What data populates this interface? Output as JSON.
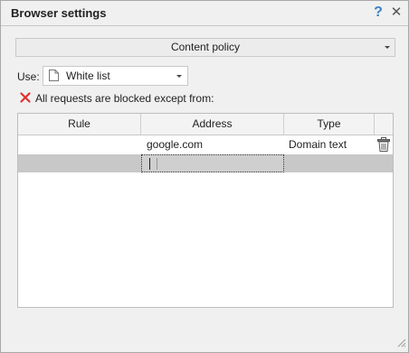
{
  "window": {
    "title": "Browser settings"
  },
  "titlebar": {
    "help_glyph": "?",
    "close_glyph": "✕"
  },
  "policy": {
    "selected": "Content policy"
  },
  "use": {
    "label": "Use:",
    "selected": "White list",
    "icon": "document-icon"
  },
  "notice": {
    "icon": "red-x-icon",
    "text": "All requests are blocked except from:",
    "icon_color": "#e0312f"
  },
  "table": {
    "columns": [
      "Rule",
      "Address",
      "Type"
    ],
    "rows": [
      {
        "rule": "",
        "address": "google.com",
        "type": "Domain text"
      },
      {
        "rule": "",
        "address": "",
        "type": ""
      }
    ],
    "delete_icon": "trash-icon",
    "selected_row_color": "#c8c8c8"
  }
}
